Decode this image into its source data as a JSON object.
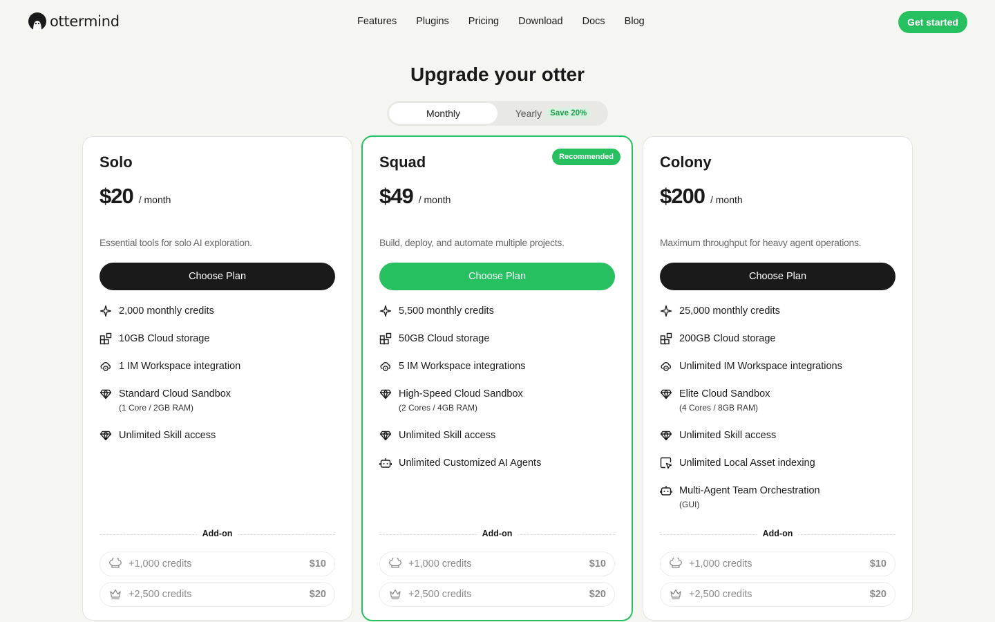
{
  "brand": {
    "name": "ottermind"
  },
  "nav": [
    "Features",
    "Plugins",
    "Pricing",
    "Download",
    "Docs",
    "Blog"
  ],
  "cta": "Get started",
  "title": "Upgrade your otter",
  "billing": {
    "monthly": "Monthly",
    "yearly": "Yearly",
    "save": "Save 20%",
    "selected": "Monthly"
  },
  "colors": {
    "accent": "#27c061",
    "dark": "#1a1a1a",
    "background": "#f5f5f2"
  },
  "plans": [
    {
      "name": "Solo",
      "price": "$20",
      "period": "/ month",
      "description": "Essential tools for solo AI exploration.",
      "button": "Choose Plan",
      "recommended": "",
      "features": [
        {
          "icon": "sparkle-icon",
          "text": "2,000 monthly credits",
          "sub": ""
        },
        {
          "icon": "blocks-icon",
          "text": "10GB Cloud storage",
          "sub": ""
        },
        {
          "icon": "cloud-chat-icon",
          "text": "1 IM Workspace integration",
          "sub": ""
        },
        {
          "icon": "diamond-icon",
          "text": "Standard Cloud Sandbox",
          "sub": "(1 Core / 2GB RAM)"
        },
        {
          "icon": "diamond-icon",
          "text": "Unlimited Skill access",
          "sub": ""
        }
      ],
      "addon_label": "Add-on",
      "addons": [
        {
          "icon": "chef-hat-icon",
          "label": "+1,000 credits",
          "price": "$10"
        },
        {
          "icon": "crown-icon",
          "label": "+2,500 credits",
          "price": "$20"
        }
      ]
    },
    {
      "name": "Squad",
      "price": "$49",
      "period": "/ month",
      "description": "Build, deploy, and automate multiple projects.",
      "button": "Choose Plan",
      "recommended": "Recommended",
      "features": [
        {
          "icon": "sparkle-icon",
          "text": "5,500 monthly credits",
          "sub": ""
        },
        {
          "icon": "blocks-icon",
          "text": "50GB Cloud storage",
          "sub": ""
        },
        {
          "icon": "cloud-chat-icon",
          "text": "5 IM Workspace integrations",
          "sub": ""
        },
        {
          "icon": "diamond-icon",
          "text": "High-Speed Cloud Sandbox",
          "sub": "(2 Cores / 4GB RAM)"
        },
        {
          "icon": "diamond-icon",
          "text": "Unlimited Skill access",
          "sub": ""
        },
        {
          "icon": "robot-icon",
          "text": "Unlimited Customized AI Agents",
          "sub": ""
        }
      ],
      "addon_label": "Add-on",
      "addons": [
        {
          "icon": "chef-hat-icon",
          "label": "+1,000 credits",
          "price": "$10"
        },
        {
          "icon": "crown-icon",
          "label": "+2,500 credits",
          "price": "$20"
        }
      ]
    },
    {
      "name": "Colony",
      "price": "$200",
      "period": "/ month",
      "description": "Maximum throughput for heavy agent operations.",
      "button": "Choose Plan",
      "recommended": "",
      "features": [
        {
          "icon": "sparkle-icon",
          "text": "25,000 monthly credits",
          "sub": ""
        },
        {
          "icon": "blocks-icon",
          "text": "200GB Cloud storage",
          "sub": ""
        },
        {
          "icon": "cloud-chat-icon",
          "text": "Unlimited IM Workspace integrations",
          "sub": ""
        },
        {
          "icon": "diamond-icon",
          "text": "Elite Cloud Sandbox",
          "sub": "(4 Cores / 8GB RAM)"
        },
        {
          "icon": "diamond-icon",
          "text": "Unlimited Skill access",
          "sub": ""
        },
        {
          "icon": "monitor-pointer-icon",
          "text": "Unlimited Local Asset indexing",
          "sub": ""
        },
        {
          "icon": "robot-icon",
          "text": "Multi-Agent Team Orchestration",
          "sub": "(GUI)"
        }
      ],
      "addon_label": "Add-on",
      "addons": [
        {
          "icon": "chef-hat-icon",
          "label": "+1,000 credits",
          "price": "$10"
        },
        {
          "icon": "crown-icon",
          "label": "+2,500 credits",
          "price": "$20"
        }
      ]
    }
  ]
}
